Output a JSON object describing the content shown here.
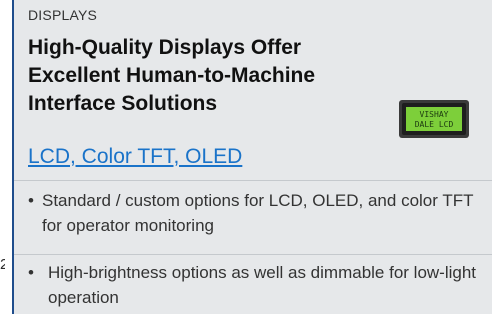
{
  "section": {
    "eyebrow": "DISPLAYS",
    "headline": "High-Quality Displays Offer Excellent Human-to-Machine Interface Solutions",
    "link_text": "LCD, Color TFT, OLED",
    "image": {
      "label_line1": "VISHAY",
      "label_line2": "DALE LCD",
      "icon": "lcd-module-image"
    },
    "bullets": [
      {
        "marker": "•",
        "text": "Standard / custom options for LCD, OLED, and color TFT for operator monitoring"
      },
      {
        "marker": "•",
        "text": "High-brightness options as well as dimmable for low-light operation"
      }
    ]
  },
  "left_edge_fragment": "2",
  "colors": {
    "card_background": "#e6e8ea",
    "accent_border": "#1f4d8c",
    "link": "#1a73c9",
    "lcd_screen": "#7dcf3a"
  }
}
